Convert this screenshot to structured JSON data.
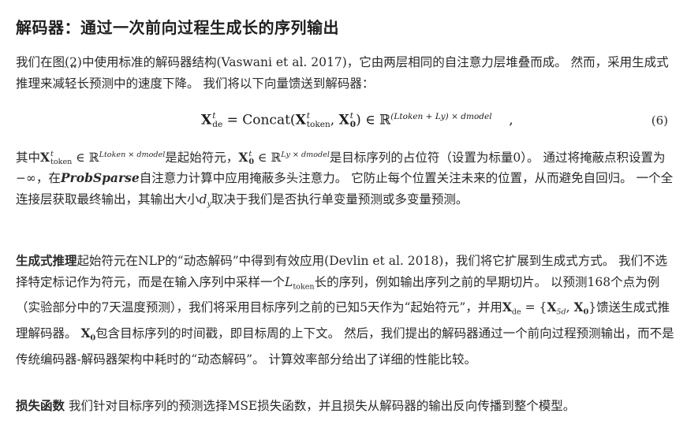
{
  "heading": "解码器：通过一次前向过程生成长的序列输出",
  "p1": {
    "part1": "我们在图",
    "figref": "(2)",
    "part2": "中使用标准的解码器结构(Vaswani et al. 2017)，它由两层相同的自注意力层堆叠而成。 然而，采用生成式推理来减轻长预测中的速度下降。 我们将以下向量馈送到解码器："
  },
  "equation": {
    "lhs_sym": "X",
    "lhs_sup": "t",
    "lhs_sub": "de",
    "eq": " = Concat(",
    "a_sym": "X",
    "a_sup": "t",
    "a_sub": "token",
    "comma": ", ",
    "b_sym": "X",
    "b_sup": "t",
    "b_sub": "0",
    "close": ") ∈ ",
    "R": "ℝ",
    "dim": "(Ltoken + Ly) × dmodel",
    "tail": "    ,",
    "number": "(6)"
  },
  "p2": {
    "t1": "其中",
    "x1": "X",
    "x1_sup": "t",
    "x1_sub": "token",
    "in1": " ∈ ℝ",
    "dim1": "Ltoken × dmodel",
    "t2": "是起始符元，",
    "x2": "X",
    "x2_sup": "t",
    "x2_sub": "0",
    "in2": " ∈ ℝ",
    "dim2": "Ly × dmodel",
    "t3": "是目标序列的占位符（设置为标量0）。 通过将掩蔽点积设置为−∞，在",
    "probsparse": "ProbSparse",
    "t4": "自注意力计算中应用掩蔽多头注意力。 它防止每个位置关注未来的位置，从而避免自回归。 一个全连接层获取最终输出，其输出大小",
    "dy": "d",
    "dy_sub": "y",
    "t5": "取决于我们是否执行单变量预测或多变量预测。"
  },
  "p3": {
    "lead": "生成式推理",
    "t1": "起始符元在NLP的“动态解码”中得到有效应用(Devlin et al. 2018)，我们将它扩展到生成式方式。 我们不选择特定标记作为符元，而是在输入序列中采样一个",
    "L": "L",
    "L_sub": "token",
    "t2": "长的序列，例如输出序列之前的早期切片。 以预测168个点为例（实验部分中的7天温度预测），我们将采用目标序列之前的已知5天作为“起始符元”，并用",
    "x": "X",
    "x_sub": "de",
    "set": " = {",
    "x5": "X",
    "x5_sub": "5d",
    "comma": ", ",
    "x0": "X",
    "x0_sub": "0",
    "setc": "}",
    "t3": "馈送生成式推理解码器。 ",
    "x0b": "X",
    "x0b_sub": "0",
    "t4": "包含目标序列的时间戳，即目标周的上下文。 然后，我们提出的解码器通过一个前向过程预测输出，而不是传统编码器-解码器架构中耗时的“动态解码”。 计算效率部分给出了详细的性能比较。"
  },
  "p4": {
    "lead": "损失函数",
    "text": " 我们针对目标序列的预测选择MSE损失函数，并且损失从解码器的输出反向传播到整个模型。"
  }
}
